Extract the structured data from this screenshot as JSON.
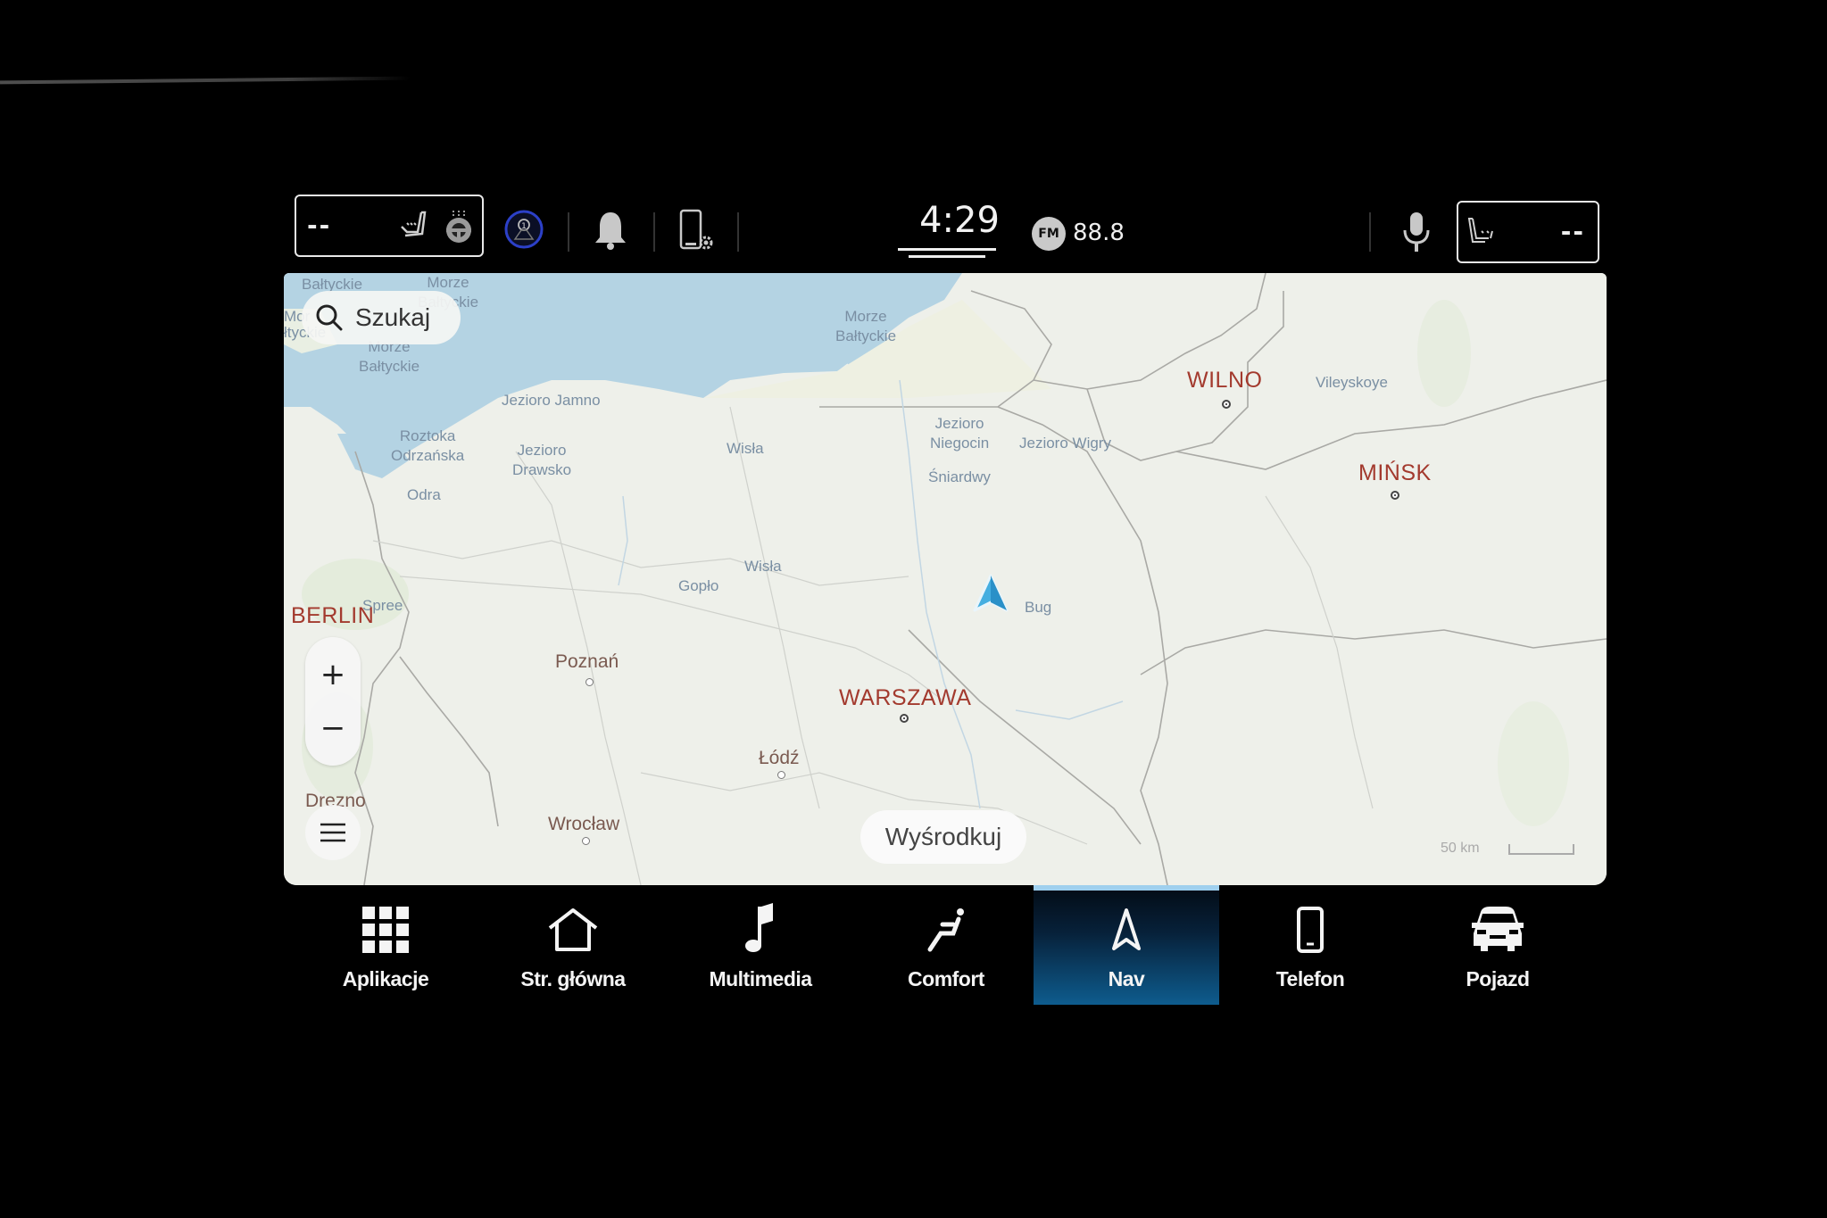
{
  "status_bar": {
    "left_temp": "--",
    "right_temp": "--",
    "left_seat_icon": "seat-heat-icon",
    "steering_icon": "heated-steering-wheel-icon",
    "driver_assist_icon": "driver-alert-icon",
    "notifications_icon": "bell-icon",
    "phone_settings_icon": "phone-settings-icon",
    "time": "4:29",
    "radio_band": "FM",
    "radio_frequency": "88.8",
    "mic_icon": "microphone-icon",
    "right_seat_icon": "seat-heat-icon"
  },
  "map": {
    "search_label": "Szukaj",
    "zoom_in": "+",
    "zoom_out": "−",
    "recenter_label": "Wyśrodkuj",
    "scale_label": "50 km",
    "water_labels": [
      {
        "text": "Bałtyckie"
      },
      {
        "text": "Morze\nBałtyckie"
      },
      {
        "text": "Mor"
      },
      {
        "text": "łtyckie"
      },
      {
        "text": "Morze\nBałtyckie"
      },
      {
        "text": "Morze\nBałtyckie"
      },
      {
        "text": "Jezioro Jamno"
      },
      {
        "text": "Roztoka\nOdrzańska"
      },
      {
        "text": "Jezioro\nDrawsko"
      },
      {
        "text": "Odra"
      },
      {
        "text": "Wisła"
      },
      {
        "text": "Jezioro\nNiegocin"
      },
      {
        "text": "Jezioro Wigry"
      },
      {
        "text": "Śniardwy"
      },
      {
        "text": "Vileyskoye"
      },
      {
        "text": "Spree"
      },
      {
        "text": "Gopło"
      },
      {
        "text": "Wisła"
      },
      {
        "text": "Bug"
      }
    ],
    "capitals": [
      {
        "name": "WILNO"
      },
      {
        "name": "MIŃSK"
      },
      {
        "name": "BERLIN"
      },
      {
        "name": "WARSZAWA"
      }
    ],
    "cities": [
      {
        "name": "Poznań"
      },
      {
        "name": "Łódź"
      },
      {
        "name": "Drezno"
      },
      {
        "name": "Wrocław"
      }
    ]
  },
  "bottom_nav": {
    "items": [
      {
        "label": "Aplikacje",
        "icon": "apps-grid-icon"
      },
      {
        "label": "Str. główna",
        "icon": "home-icon"
      },
      {
        "label": "Multimedia",
        "icon": "music-note-icon"
      },
      {
        "label": "Comfort",
        "icon": "seat-comfort-icon"
      },
      {
        "label": "Nav",
        "icon": "navigation-arrow-icon",
        "active": true
      },
      {
        "label": "Telefon",
        "icon": "phone-icon"
      },
      {
        "label": "Pojazd",
        "icon": "car-icon"
      }
    ],
    "active_color": "#0e5c8e"
  }
}
